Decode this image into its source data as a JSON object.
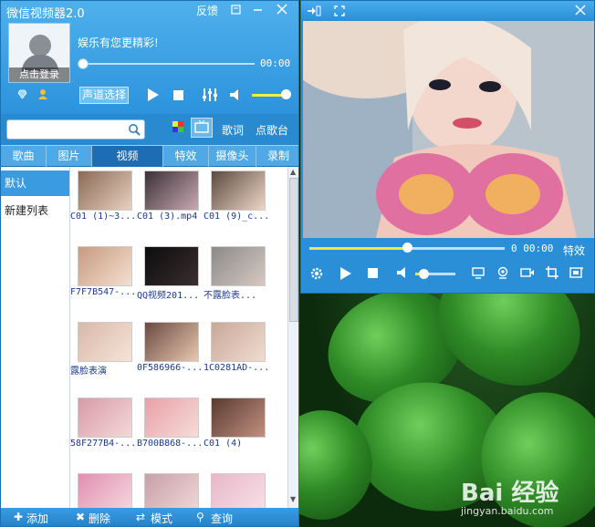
{
  "app": {
    "title": "微信视频器2.0",
    "feedback": "反馈",
    "tagline": "娱乐有您更精彩!",
    "login": "点击登录",
    "time": "00:00",
    "channel_select": "声道选择",
    "volume_level": 1.0,
    "progress_fraction": 0.0
  },
  "search": {
    "value": "",
    "lyrics": "歌词",
    "request": "点歌台"
  },
  "tabs": [
    "歌曲",
    "图片",
    "视频",
    "特效",
    "摄像头",
    "录制"
  ],
  "active_tab": "视频",
  "playlists": [
    "默认",
    "新建列表"
  ],
  "videos": [
    {
      "caption": "C01 (1)~3..."
    },
    {
      "caption": "C01 (3).mp4"
    },
    {
      "caption": "C01 (9)_c..."
    },
    {
      "caption": "F7F7B547-..."
    },
    {
      "caption": "QQ视频201..."
    },
    {
      "caption": "不露脸表..."
    },
    {
      "caption": "露脸表演"
    },
    {
      "caption": "0F586966-..."
    },
    {
      "caption": "1C0281AD-..."
    },
    {
      "caption": "58F277B4-..."
    },
    {
      "caption": "B700B868-..."
    },
    {
      "caption": "C01 (4)"
    },
    {
      "caption": ""
    },
    {
      "caption": ""
    },
    {
      "caption": ""
    }
  ],
  "bottom_bar": {
    "add": "添加",
    "delete": "删除",
    "mode": "模式",
    "query": "查询"
  },
  "video_window": {
    "time": "0 00:00",
    "effects": "特效",
    "progress_fraction": 0.5,
    "volume_level": 0.2
  },
  "watermark": {
    "brand": "Bai 经验",
    "url": "jingyan.baidu.com"
  },
  "colors": {
    "panel_blue": "#2a8fd6",
    "accent_yellow": "#f0e640",
    "link_blue": "#1a3a8a"
  }
}
